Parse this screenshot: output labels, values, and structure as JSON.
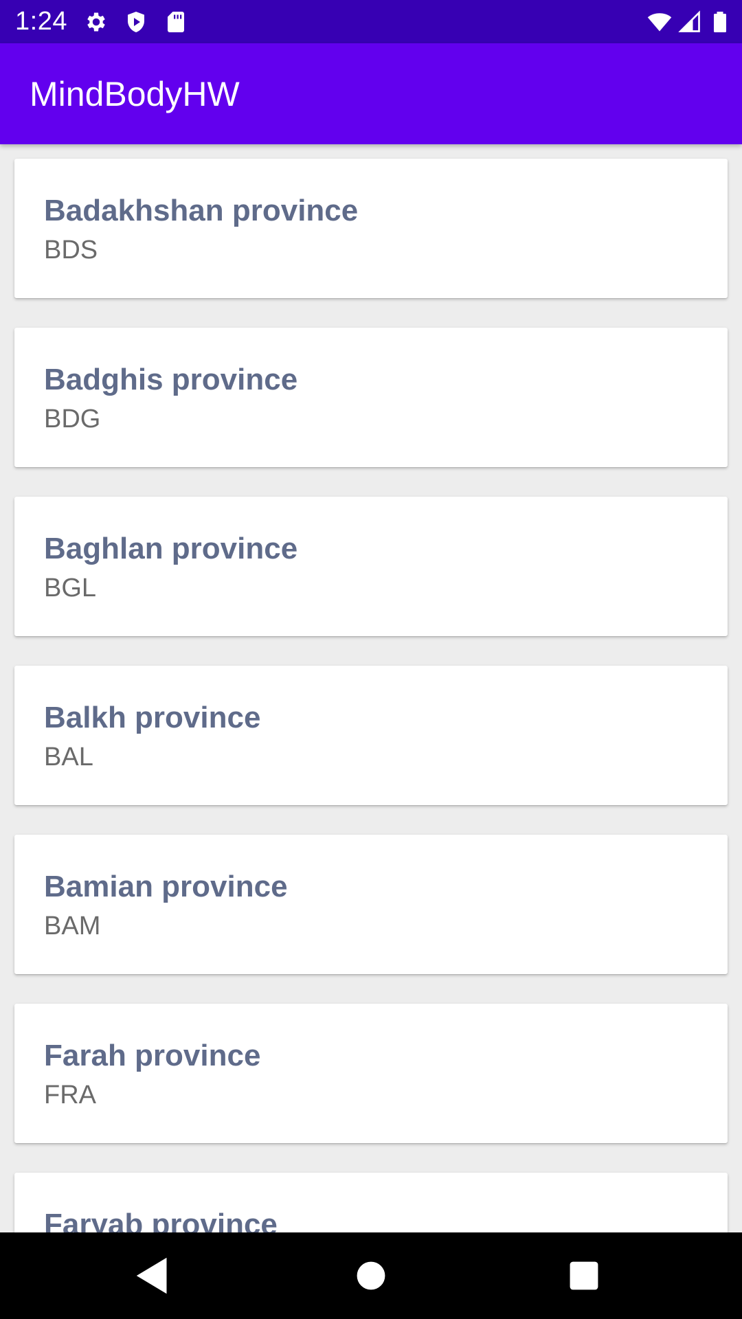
{
  "status_bar": {
    "time": "1:24",
    "left_icons": [
      "gear-icon",
      "shield-play-icon",
      "sd-card-icon"
    ],
    "right_icons": [
      "wifi-icon",
      "signal-icon",
      "battery-icon"
    ]
  },
  "app_bar": {
    "title": "MindBodyHW",
    "color": "#6200ee"
  },
  "provinces": [
    {
      "name": "Badakhshan province",
      "code": "BDS"
    },
    {
      "name": "Badghis province",
      "code": "BDG"
    },
    {
      "name": "Baghlan province",
      "code": "BGL"
    },
    {
      "name": "Balkh province",
      "code": "BAL"
    },
    {
      "name": "Bamian province",
      "code": "BAM"
    },
    {
      "name": "Farah province",
      "code": "FRA"
    },
    {
      "name": "Faryab province",
      "code": ""
    }
  ],
  "nav_bar": {
    "buttons": [
      "back-icon",
      "home-icon",
      "recents-icon"
    ]
  },
  "colors": {
    "status_bar": "#3700b3",
    "app_bar": "#6200ee",
    "title_text": "#5f6b8a",
    "code_text": "#6a6a6a",
    "background": "#ededed"
  }
}
